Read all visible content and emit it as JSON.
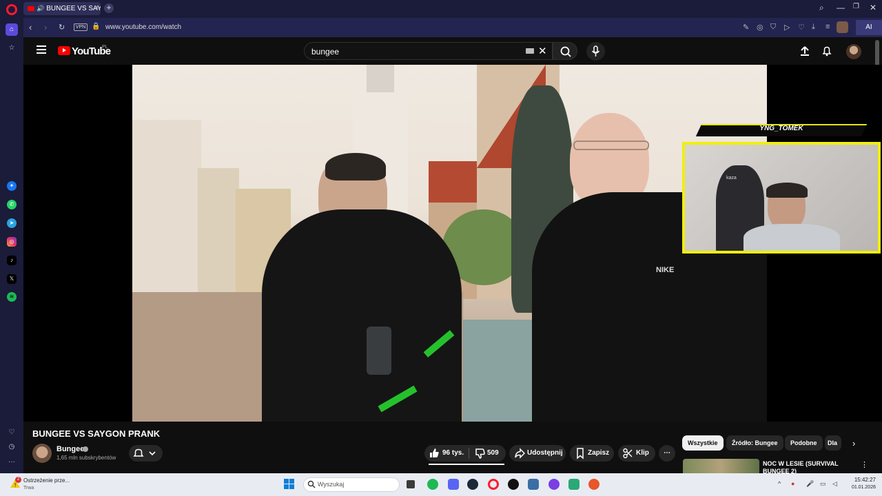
{
  "browser": {
    "tab_title": "BUNGEE VS SAYGON",
    "url": "www.youtube.com/watch",
    "vpn_label": "VPN",
    "ai_label": "AI",
    "accent": "#ff1b2d"
  },
  "youtube": {
    "logo_text": "YouTube",
    "region": "PL",
    "search_value": "bungee"
  },
  "stream_overlay": {
    "name": "YNG_TOMEK",
    "chair_brand": "kaza"
  },
  "video": {
    "title": "BUNGEE VS SAYGON PRANK",
    "channel": "Bungee",
    "subscribers": "1,65 mln subskrybentów",
    "likes": "96 tys.",
    "dislikes": "509",
    "share_label": "Udostępnij",
    "save_label": "Zapisz",
    "clip_label": "Klip"
  },
  "chips": [
    "Wszystkie",
    "Źródło: Bungee",
    "Podobne",
    "Dla"
  ],
  "recommendation": {
    "title": "NOC W LESIE (SURVIVAL BUNGEE 2)"
  },
  "taskbar": {
    "notification_title": "Ostrzeżenie prze...",
    "notification_sub": "Trwa",
    "notification_count": "2",
    "search_placeholder": "Wyszukaj",
    "time": "15:42:27",
    "date": "01.01.2026"
  },
  "icons": [
    "opera-icon",
    "home-icon",
    "star-icon",
    "messenger-icon",
    "whatsapp-icon",
    "telegram-icon",
    "instagram-icon",
    "tiktok-icon",
    "x-icon",
    "spotify-icon",
    "heart-icon",
    "history-icon",
    "more-icon"
  ]
}
